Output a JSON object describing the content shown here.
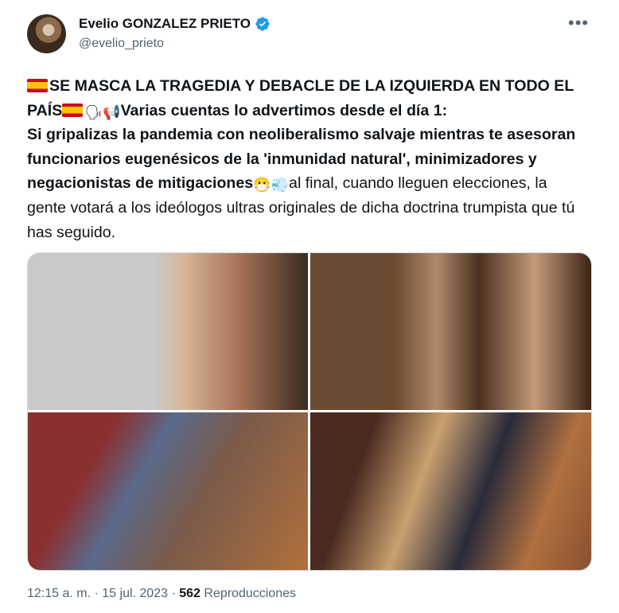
{
  "author": {
    "name": "Evelio GONZALEZ PRIETO",
    "handle": "@evelio_prieto",
    "verified_icon": "verified-badge-icon",
    "verified_color": "#1d9bf0"
  },
  "more_label": "•••",
  "tweet": {
    "seg1": "SE MASCA LA TRAGEDIA Y DEBACLE DE LA IZQUIERDA EN TODO EL PAÍS",
    "seg2": "Varias cuentas lo advertimos desde el día 1:",
    "seg3": "Si gripalizas la pandemia con neoliberalismo salvaje mientras te asesoran funcionarios eugenésicos de la 'inmunidad natural', minimizadores y negacionistas de mitigaciones",
    "seg4": "al final, cuando lleguen elecciones, la gente votará a los ideólogos ultras originales de dicha doctrina trumpista que tú has seguido.",
    "emoji_speaking": "🗣",
    "emoji_megaphone": "📢",
    "emoji_mask": "😷",
    "emoji_dash": "💨"
  },
  "media": {
    "photos": [
      {
        "name": "photo-crying-man-closeup"
      },
      {
        "name": "photo-man-wiping-eye-crowd"
      },
      {
        "name": "photo-man-with-tissue-parliament"
      },
      {
        "name": "photo-woman-masked-wiping-eyes"
      }
    ]
  },
  "footer": {
    "time": "12:15 a. m.",
    "sep1": " · ",
    "date": "15 jul. 2023",
    "sep2": " · ",
    "views_count": "562",
    "views_label": "Reproducciones"
  }
}
